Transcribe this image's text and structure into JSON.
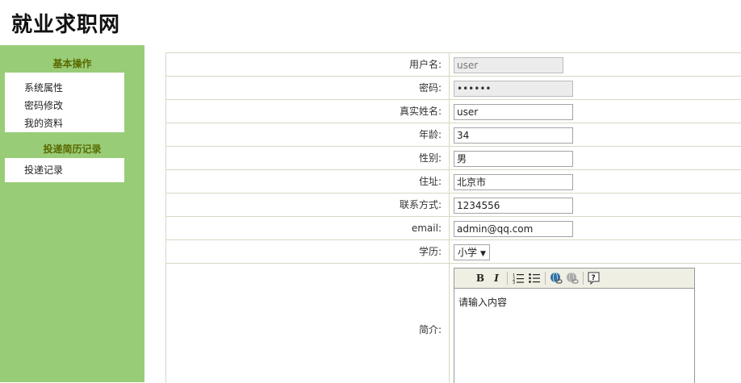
{
  "header": {
    "title": "就业求职网"
  },
  "sidebar": {
    "sections": [
      {
        "title": "基本操作",
        "items": [
          "系统属性",
          "密码修改",
          "我的资料"
        ]
      },
      {
        "title": "投递简历记录",
        "items": [
          "投递记录"
        ]
      }
    ]
  },
  "form": {
    "username": {
      "label": "用户名:",
      "value": "user"
    },
    "password": {
      "label": "密码:",
      "value": "••••••"
    },
    "realname": {
      "label": "真实姓名:",
      "value": "user"
    },
    "age": {
      "label": "年龄:",
      "value": "34"
    },
    "gender": {
      "label": "性别:",
      "value": "男"
    },
    "address": {
      "label": "住址:",
      "value": "北京市"
    },
    "contact": {
      "label": "联系方式:",
      "value": "1234556"
    },
    "email": {
      "label": "email:",
      "value": "admin@qq.com"
    },
    "education": {
      "label": "学历:",
      "selected": "小学"
    },
    "intro": {
      "label": "简介:",
      "content": "请输入内容",
      "toolbar_icons": [
        "bold-icon",
        "italic-icon",
        "ordered-list-icon",
        "unordered-list-icon",
        "link-icon",
        "unlink-icon",
        "help-icon"
      ]
    }
  }
}
